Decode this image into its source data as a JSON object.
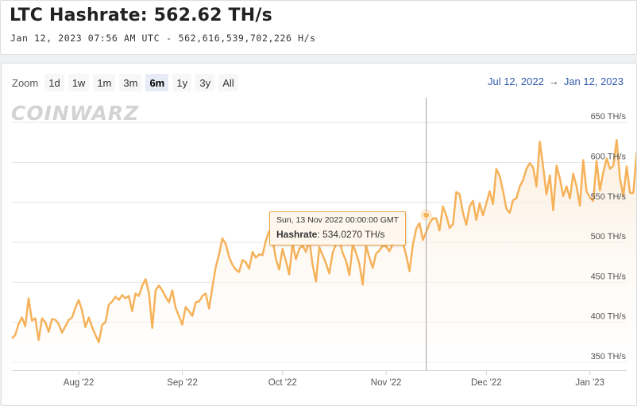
{
  "header": {
    "title": "LTC Hashrate: 562.62 TH/s",
    "timestamp": "Jan 12, 2023 07:56 AM UTC",
    "separator": "-",
    "raw_value": "562,616,539,702,226 H/s"
  },
  "zoom": {
    "label": "Zoom",
    "buttons": [
      "1d",
      "1w",
      "1m",
      "3m",
      "6m",
      "1y",
      "3y",
      "All"
    ],
    "active": "6m"
  },
  "range": {
    "from": "Jul 12, 2022",
    "arrow": "→",
    "to": "Jan 12, 2023"
  },
  "watermark": {
    "text": "COINWARZ"
  },
  "tooltip": {
    "date": "Sun, 13 Nov 2022 00:00:00 GMT",
    "series_label": "Hashrate",
    "value": "534.0270 TH/s"
  },
  "colors": {
    "line": "#f5b25a",
    "area_top": "#fbe9d4",
    "grid": "#e6e6e6",
    "crosshair": "#a0a0a0",
    "accent": "#335cad"
  },
  "chart_data": {
    "type": "area",
    "title": "",
    "xlabel": "",
    "ylabel": "",
    "y_unit": "TH/s",
    "ylim": [
      340,
      680
    ],
    "y_ticks": [
      350,
      400,
      450,
      500,
      550,
      600,
      650
    ],
    "y_tick_labels": [
      "350 TH/s",
      "400 TH/s",
      "450 TH/s",
      "500 TH/s",
      "550 TH/s",
      "600 TH/s",
      "650 TH/s"
    ],
    "x_tick_labels": [
      "Aug '22",
      "Sep '22",
      "Oct '22",
      "Nov '22",
      "Dec '22",
      "Jan '23"
    ],
    "x_tick_dates": [
      "2022-08-01",
      "2022-09-01",
      "2022-10-01",
      "2022-11-01",
      "2022-12-01",
      "2023-01-01"
    ],
    "x_range": [
      "2022-07-12",
      "2023-01-12"
    ],
    "grid": true,
    "legend": "none",
    "series": [
      {
        "start_date": "2022-07-12",
        "values": [
          380,
          384,
          398,
          406,
          395,
          430,
          402,
          405,
          378,
          405,
          400,
          388,
          404,
          403,
          398,
          387,
          395,
          403,
          406,
          418,
          428,
          415,
          394,
          406,
          394,
          384,
          375,
          397,
          400,
          422,
          426,
          432,
          428,
          434,
          430,
          433,
          414,
          436,
          433,
          446,
          454,
          437,
          393,
          440,
          446,
          440,
          432,
          425,
          440,
          418,
          408,
          397,
          419,
          414,
          408,
          425,
          426,
          433,
          436,
          417,
          444,
          469,
          485,
          505,
          498,
          482,
          472,
          466,
          463,
          478,
          475,
          467,
          488,
          481,
          485,
          484,
          502,
          514,
          504,
          480,
          466,
          492,
          477,
          460,
          498,
          479,
          492,
          496,
          488,
          503,
          472,
          451,
          494,
          484,
          474,
          461,
          487,
          498,
          503,
          487,
          477,
          459,
          497,
          487,
          473,
          447,
          496,
          481,
          468,
          486,
          490,
          496,
          495,
          489,
          498,
          503,
          518,
          500,
          484,
          464,
          497,
          517,
          524,
          503,
          513,
          524,
          530,
          530,
          515,
          545,
          534,
          518,
          523,
          563,
          560,
          537,
          522,
          545,
          552,
          528,
          549,
          534,
          549,
          564,
          548,
          592,
          583,
          564,
          542,
          537,
          553,
          555,
          570,
          578,
          592,
          599,
          594,
          570,
          626,
          595,
          560,
          584,
          540,
          596,
          580,
          558,
          570,
          555,
          586,
          570,
          546,
          603,
          564,
          556,
          552,
          602,
          565,
          588,
          605,
          592,
          596,
          628,
          580,
          558,
          595,
          562,
          562,
          612,
          633,
          627,
          560,
          613,
          578,
          603,
          588,
          594,
          582,
          570,
          601,
          620,
          590,
          584,
          590,
          623,
          562
        ]
      }
    ]
  }
}
